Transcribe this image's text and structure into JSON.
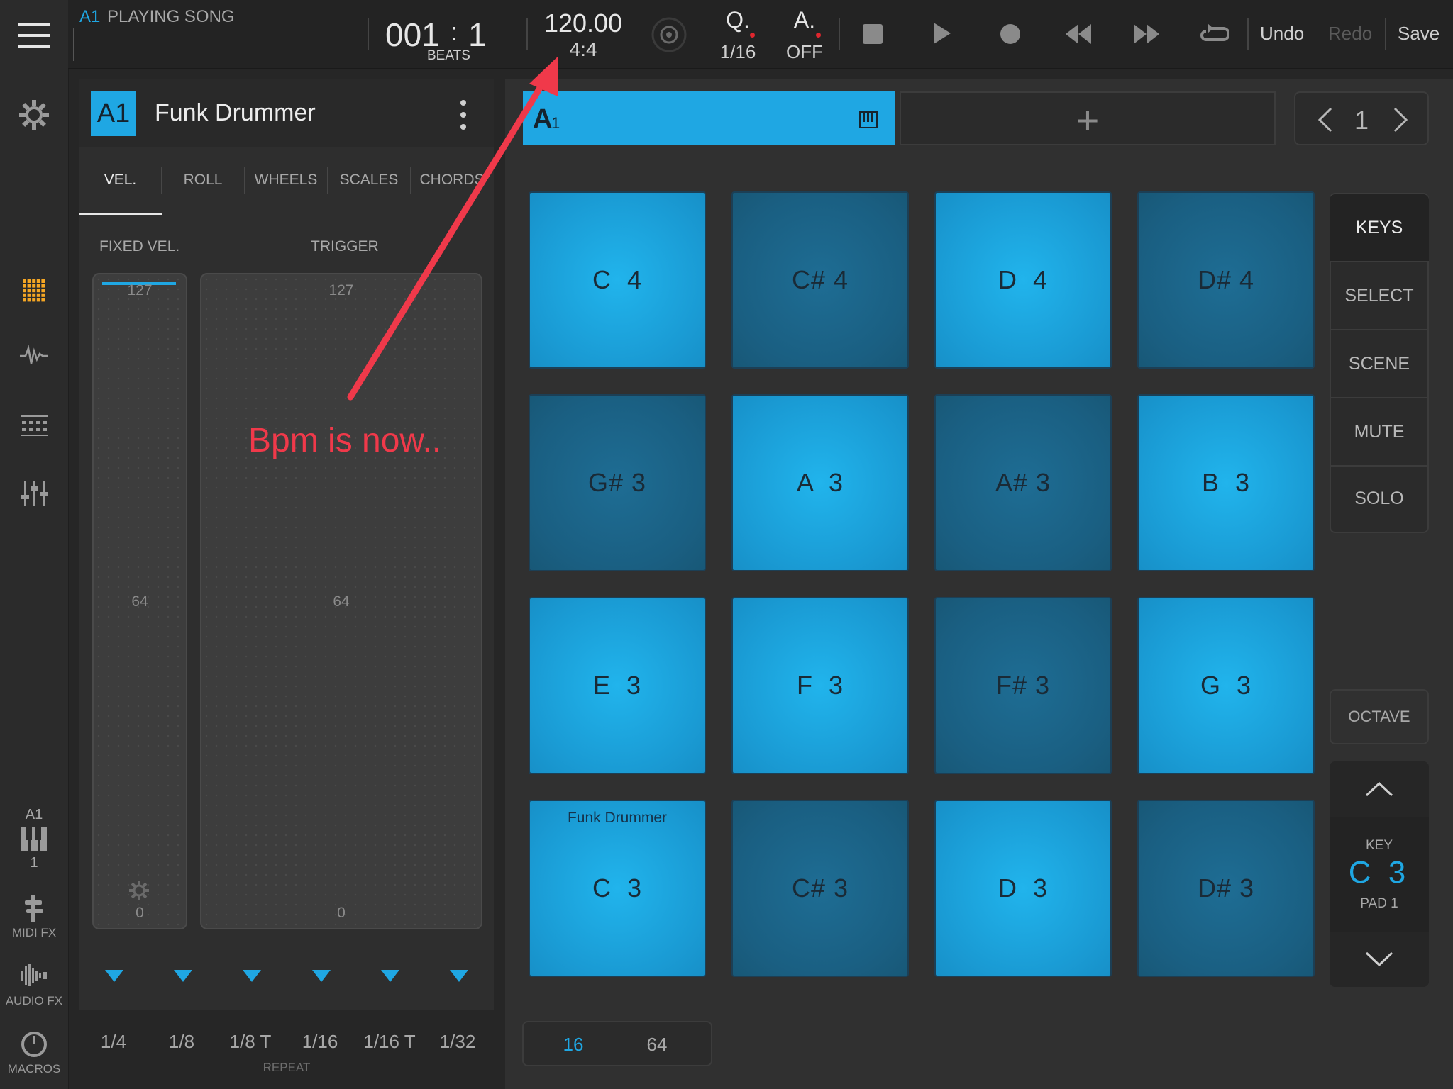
{
  "topbar": {
    "song_prefix": "A1",
    "song_status": "PLAYING SONG",
    "position_bar": "001",
    "position_colon": ":",
    "position_beat": "1",
    "position_unit": "BEATS",
    "tempo": "120.00",
    "time_signature": "4:4",
    "quantize_label": "Q.",
    "quantize_value": "1/16",
    "automation_label": "A.",
    "automation_value": "OFF",
    "undo": "Undo",
    "redo": "Redo",
    "save": "Save"
  },
  "rail": {
    "track_label": "A1",
    "track_number": "1",
    "midi_fx": "MIDI FX",
    "audio_fx": "AUDIO FX",
    "macros": "MACROS"
  },
  "track": {
    "badge": "A1",
    "name": "Funk Drummer"
  },
  "tabs": [
    "VEL.",
    "ROLL",
    "WHEELS",
    "SCALES",
    "CHORDS"
  ],
  "velocity": {
    "fixed_label": "FIXED VEL.",
    "trigger_label": "TRIGGER",
    "max": "127",
    "mid": "64",
    "min": "0"
  },
  "repeat": {
    "options": [
      "1/4",
      "1/8",
      "1/8 T",
      "1/16",
      "1/16 T",
      "1/32"
    ],
    "label": "REPEAT"
  },
  "clip": {
    "name": "A",
    "number": "1",
    "add": "+",
    "page": "1"
  },
  "pads": [
    {
      "note": "C  4",
      "tone": "light",
      "name": ""
    },
    {
      "note": "C# 4",
      "tone": "dark",
      "name": ""
    },
    {
      "note": "D  4",
      "tone": "light",
      "name": ""
    },
    {
      "note": "D# 4",
      "tone": "dark",
      "name": ""
    },
    {
      "note": "G# 3",
      "tone": "dark",
      "name": ""
    },
    {
      "note": "A  3",
      "tone": "light",
      "name": ""
    },
    {
      "note": "A# 3",
      "tone": "dark",
      "name": ""
    },
    {
      "note": "B  3",
      "tone": "light",
      "name": ""
    },
    {
      "note": "E  3",
      "tone": "light",
      "name": ""
    },
    {
      "note": "F  3",
      "tone": "light",
      "name": ""
    },
    {
      "note": "F# 3",
      "tone": "dark",
      "name": ""
    },
    {
      "note": "G  3",
      "tone": "light",
      "name": ""
    },
    {
      "note": "C  3",
      "tone": "light",
      "name": "Funk Drummer"
    },
    {
      "note": "C# 3",
      "tone": "dark",
      "name": ""
    },
    {
      "note": "D  3",
      "tone": "light",
      "name": ""
    },
    {
      "note": "D# 3",
      "tone": "dark",
      "name": ""
    }
  ],
  "modes": [
    "KEYS",
    "SELECT",
    "SCENE",
    "MUTE",
    "SOLO"
  ],
  "octave": {
    "label": "OCTAVE",
    "key_label": "KEY",
    "key_value": "C 3",
    "pad_label": "PAD 1"
  },
  "pad_count": {
    "option_a": "16",
    "option_b": "64"
  },
  "annotation": {
    "text": "Bpm is now.."
  },
  "colors": {
    "accent": "#1fa7e3",
    "annotation": "#f0394a",
    "rail_active": "#f5a623"
  }
}
